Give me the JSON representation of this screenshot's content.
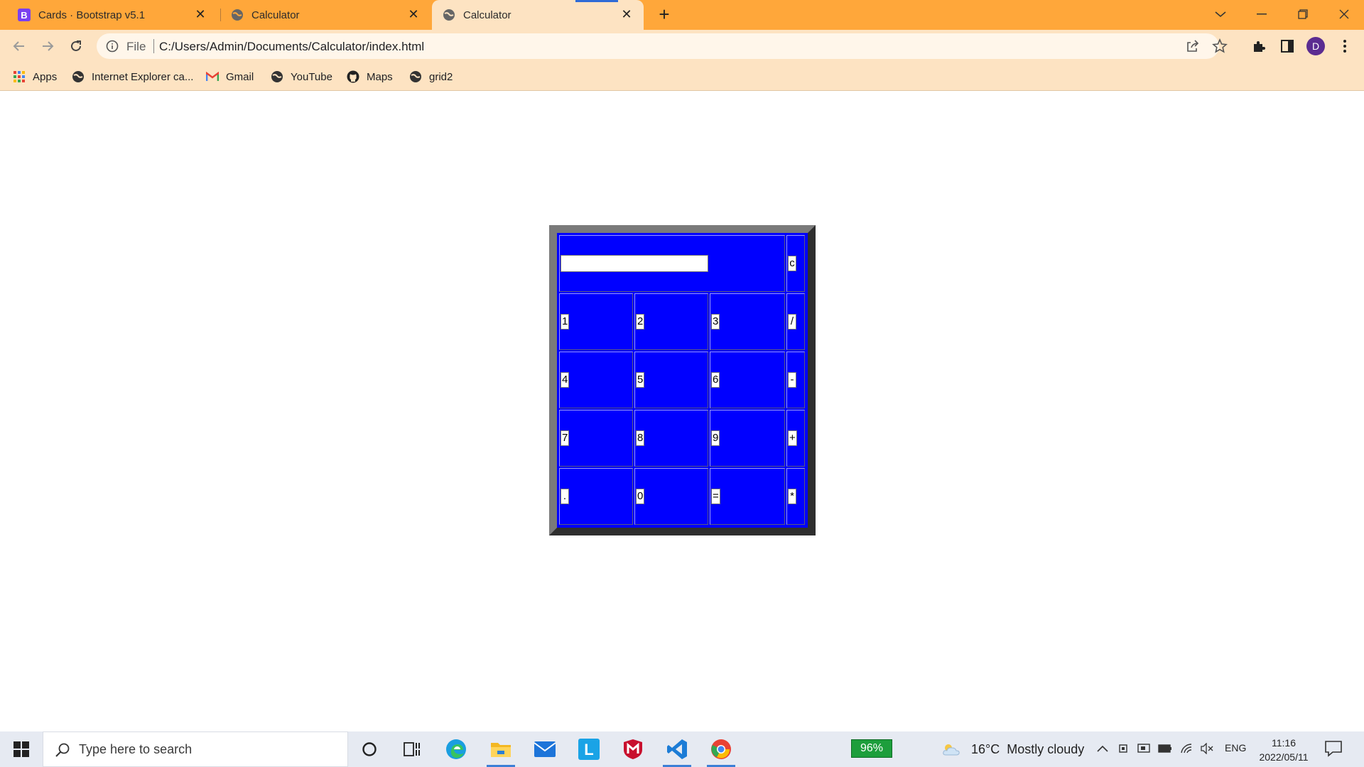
{
  "browser": {
    "tabs": [
      {
        "title": "Cards · Bootstrap v5.1",
        "favicon": "bootstrap-icon",
        "active": false
      },
      {
        "title": "Calculator",
        "favicon": "globe-icon",
        "active": false
      },
      {
        "title": "Calculator",
        "favicon": "globe-icon",
        "active": true
      }
    ],
    "address": {
      "scheme_label": "File",
      "url": "C:/Users/Admin/Documents/Calculator/index.html"
    },
    "profile_initial": "D",
    "bookmarks": [
      {
        "label": "Apps",
        "icon": "apps-grid-icon"
      },
      {
        "label": "Internet Explorer ca...",
        "icon": "globe-icon"
      },
      {
        "label": "Gmail",
        "icon": "gmail-icon"
      },
      {
        "label": "YouTube",
        "icon": "globe-icon"
      },
      {
        "label": "Maps",
        "icon": "github-icon"
      },
      {
        "label": "grid2",
        "icon": "globe-icon"
      }
    ],
    "accent_color": "#ffa73a"
  },
  "calculator": {
    "display_value": "",
    "clear_label": "c",
    "rows": [
      [
        "1",
        "2",
        "3",
        "/"
      ],
      [
        "4",
        "5",
        "6",
        "-"
      ],
      [
        "7",
        "8",
        "9",
        "+"
      ],
      [
        ".",
        "0",
        "=",
        "*"
      ]
    ],
    "background_color": "#0000ff"
  },
  "taskbar": {
    "search_placeholder": "Type here to search",
    "battery_widget": "96%",
    "weather": {
      "temp": "16°C",
      "condition": "Mostly cloudy"
    },
    "language": "ENG",
    "time": "11:16",
    "date": "2022/05/11"
  }
}
